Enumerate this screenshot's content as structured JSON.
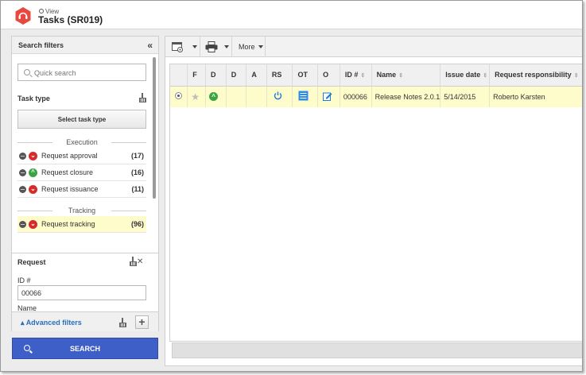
{
  "header": {
    "breadcrumb": "View",
    "title": "Tasks (SR019)"
  },
  "filters": {
    "title": "Search filters",
    "quick_search_placeholder": "Quick search",
    "task_type": {
      "title": "Task type",
      "select_button": "Select task type",
      "groups": [
        {
          "label": "Execution",
          "items": [
            {
              "label": "Request approval",
              "count": "(17)",
              "status": "red"
            },
            {
              "label": "Request closure",
              "count": "(16)",
              "status": "green"
            },
            {
              "label": "Request issuance",
              "count": "(11)",
              "status": "red"
            }
          ]
        },
        {
          "label": "Tracking",
          "items": [
            {
              "label": "Request tracking",
              "count": "(96)",
              "status": "red",
              "selected": true
            }
          ]
        }
      ]
    },
    "request": {
      "title": "Request",
      "id_label": "ID #",
      "id_value": "00066",
      "name_label": "Name"
    },
    "advanced_filters": "Advanced filters",
    "search_button": "SEARCH"
  },
  "toolbar": {
    "more_label": "More"
  },
  "grid": {
    "columns": [
      "F",
      "D",
      "D",
      "A",
      "RS",
      "OT",
      "O",
      "ID #",
      "Name",
      "Issue date",
      "Request responsibility"
    ],
    "rows": [
      {
        "id": "000066",
        "name": "Release Notes 2.0.1",
        "issue_date": "5/14/2015",
        "responsibility": "Roberto Karsten"
      }
    ]
  },
  "colors": {
    "accent": "#3d5fc7",
    "highlight": "#fefccb",
    "logo": "#e8493f",
    "status_red": "#d52b2b",
    "status_green": "#3ba544",
    "link": "#2a6ebb"
  }
}
